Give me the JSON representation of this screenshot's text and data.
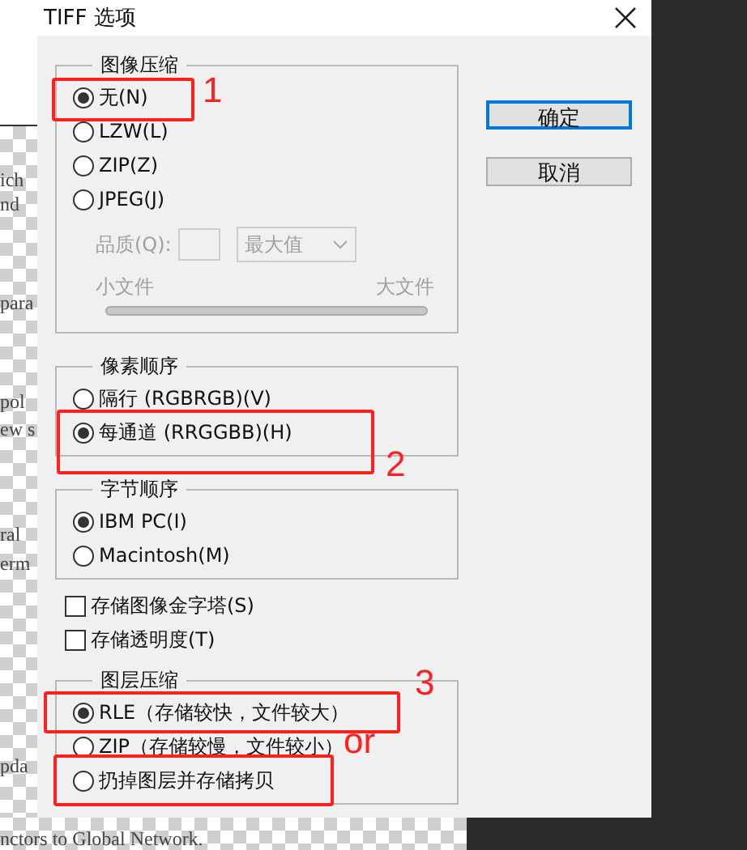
{
  "window": {
    "title": "TIFF 选项"
  },
  "image_compression": {
    "title": "图像压缩",
    "options": [
      {
        "label": "无(N)",
        "selected": true
      },
      {
        "label": "LZW(L)",
        "selected": false
      },
      {
        "label": "ZIP(Z)",
        "selected": false
      },
      {
        "label": "JPEG(J)",
        "selected": false
      }
    ],
    "quality": {
      "label": "品质(Q):",
      "value": "最大值",
      "disabled": true
    },
    "size_slider": {
      "min_label": "小文件",
      "max_label": "大文件",
      "disabled": true
    }
  },
  "pixel_order": {
    "title": "像素顺序",
    "options": [
      {
        "label": "隔行 (RGBRGB)(V)",
        "selected": false
      },
      {
        "label": "每通道 (RRGGBB)(H)",
        "selected": true
      }
    ]
  },
  "byte_order": {
    "title": "字节顺序",
    "options": [
      {
        "label": "IBM PC(I)",
        "selected": true
      },
      {
        "label": "Macintosh(M)",
        "selected": false
      }
    ]
  },
  "checkboxes": [
    {
      "label": "存储图像金字塔(S)",
      "checked": false
    },
    {
      "label": "存储透明度(T)",
      "checked": false
    }
  ],
  "layer_compression": {
    "title": "图层压缩",
    "options": [
      {
        "label": "RLE（存储较快，文件较大）",
        "selected": true
      },
      {
        "label": "ZIP（存储较慢，文件较小）",
        "selected": false
      },
      {
        "label": "扔掉图层并存储拷贝",
        "selected": false
      }
    ]
  },
  "buttons": [
    {
      "label": "确定",
      "default": true
    },
    {
      "label": "取消",
      "default": false
    }
  ],
  "annotations": [
    {
      "label": "1"
    },
    {
      "label": "2"
    },
    {
      "label": "3"
    },
    {
      "label": "or"
    }
  ],
  "background_text": [
    "ich",
    "nd",
    "para",
    "pol",
    "ew s",
    "ral",
    "erm",
    "pda",
    "nctors to Global Network."
  ]
}
